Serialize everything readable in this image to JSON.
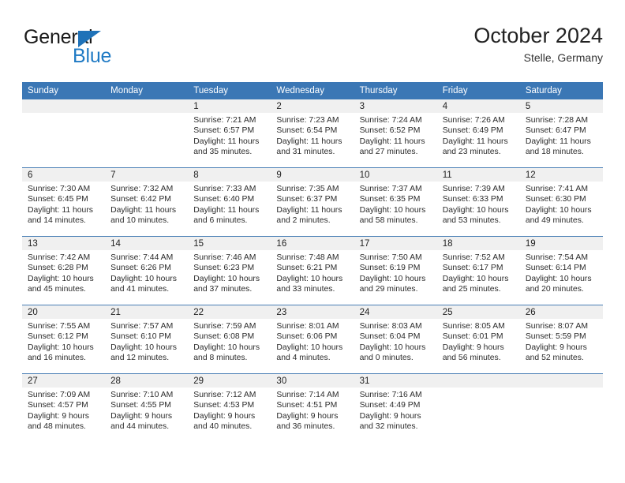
{
  "brand": {
    "name_top": "General",
    "name_bottom": "Blue",
    "triangle_color": "#1f72b8",
    "blue_color": "#1f7ac4"
  },
  "header": {
    "title": "October 2024",
    "subtitle": "Stelle, Germany"
  },
  "theme": {
    "header_bg": "#3b77b5",
    "daystrip_bg": "#f0f0f0",
    "row_divider": "#4a7fb5"
  },
  "weekdays": [
    "Sunday",
    "Monday",
    "Tuesday",
    "Wednesday",
    "Thursday",
    "Friday",
    "Saturday"
  ],
  "weeks": [
    [
      {
        "day": ""
      },
      {
        "day": ""
      },
      {
        "day": "1",
        "sunrise": "Sunrise: 7:21 AM",
        "sunset": "Sunset: 6:57 PM",
        "daylight": "Daylight: 11 hours and 35 minutes."
      },
      {
        "day": "2",
        "sunrise": "Sunrise: 7:23 AM",
        "sunset": "Sunset: 6:54 PM",
        "daylight": "Daylight: 11 hours and 31 minutes."
      },
      {
        "day": "3",
        "sunrise": "Sunrise: 7:24 AM",
        "sunset": "Sunset: 6:52 PM",
        "daylight": "Daylight: 11 hours and 27 minutes."
      },
      {
        "day": "4",
        "sunrise": "Sunrise: 7:26 AM",
        "sunset": "Sunset: 6:49 PM",
        "daylight": "Daylight: 11 hours and 23 minutes."
      },
      {
        "day": "5",
        "sunrise": "Sunrise: 7:28 AM",
        "sunset": "Sunset: 6:47 PM",
        "daylight": "Daylight: 11 hours and 18 minutes."
      }
    ],
    [
      {
        "day": "6",
        "sunrise": "Sunrise: 7:30 AM",
        "sunset": "Sunset: 6:45 PM",
        "daylight": "Daylight: 11 hours and 14 minutes."
      },
      {
        "day": "7",
        "sunrise": "Sunrise: 7:32 AM",
        "sunset": "Sunset: 6:42 PM",
        "daylight": "Daylight: 11 hours and 10 minutes."
      },
      {
        "day": "8",
        "sunrise": "Sunrise: 7:33 AM",
        "sunset": "Sunset: 6:40 PM",
        "daylight": "Daylight: 11 hours and 6 minutes."
      },
      {
        "day": "9",
        "sunrise": "Sunrise: 7:35 AM",
        "sunset": "Sunset: 6:37 PM",
        "daylight": "Daylight: 11 hours and 2 minutes."
      },
      {
        "day": "10",
        "sunrise": "Sunrise: 7:37 AM",
        "sunset": "Sunset: 6:35 PM",
        "daylight": "Daylight: 10 hours and 58 minutes."
      },
      {
        "day": "11",
        "sunrise": "Sunrise: 7:39 AM",
        "sunset": "Sunset: 6:33 PM",
        "daylight": "Daylight: 10 hours and 53 minutes."
      },
      {
        "day": "12",
        "sunrise": "Sunrise: 7:41 AM",
        "sunset": "Sunset: 6:30 PM",
        "daylight": "Daylight: 10 hours and 49 minutes."
      }
    ],
    [
      {
        "day": "13",
        "sunrise": "Sunrise: 7:42 AM",
        "sunset": "Sunset: 6:28 PM",
        "daylight": "Daylight: 10 hours and 45 minutes."
      },
      {
        "day": "14",
        "sunrise": "Sunrise: 7:44 AM",
        "sunset": "Sunset: 6:26 PM",
        "daylight": "Daylight: 10 hours and 41 minutes."
      },
      {
        "day": "15",
        "sunrise": "Sunrise: 7:46 AM",
        "sunset": "Sunset: 6:23 PM",
        "daylight": "Daylight: 10 hours and 37 minutes."
      },
      {
        "day": "16",
        "sunrise": "Sunrise: 7:48 AM",
        "sunset": "Sunset: 6:21 PM",
        "daylight": "Daylight: 10 hours and 33 minutes."
      },
      {
        "day": "17",
        "sunrise": "Sunrise: 7:50 AM",
        "sunset": "Sunset: 6:19 PM",
        "daylight": "Daylight: 10 hours and 29 minutes."
      },
      {
        "day": "18",
        "sunrise": "Sunrise: 7:52 AM",
        "sunset": "Sunset: 6:17 PM",
        "daylight": "Daylight: 10 hours and 25 minutes."
      },
      {
        "day": "19",
        "sunrise": "Sunrise: 7:54 AM",
        "sunset": "Sunset: 6:14 PM",
        "daylight": "Daylight: 10 hours and 20 minutes."
      }
    ],
    [
      {
        "day": "20",
        "sunrise": "Sunrise: 7:55 AM",
        "sunset": "Sunset: 6:12 PM",
        "daylight": "Daylight: 10 hours and 16 minutes."
      },
      {
        "day": "21",
        "sunrise": "Sunrise: 7:57 AM",
        "sunset": "Sunset: 6:10 PM",
        "daylight": "Daylight: 10 hours and 12 minutes."
      },
      {
        "day": "22",
        "sunrise": "Sunrise: 7:59 AM",
        "sunset": "Sunset: 6:08 PM",
        "daylight": "Daylight: 10 hours and 8 minutes."
      },
      {
        "day": "23",
        "sunrise": "Sunrise: 8:01 AM",
        "sunset": "Sunset: 6:06 PM",
        "daylight": "Daylight: 10 hours and 4 minutes."
      },
      {
        "day": "24",
        "sunrise": "Sunrise: 8:03 AM",
        "sunset": "Sunset: 6:04 PM",
        "daylight": "Daylight: 10 hours and 0 minutes."
      },
      {
        "day": "25",
        "sunrise": "Sunrise: 8:05 AM",
        "sunset": "Sunset: 6:01 PM",
        "daylight": "Daylight: 9 hours and 56 minutes."
      },
      {
        "day": "26",
        "sunrise": "Sunrise: 8:07 AM",
        "sunset": "Sunset: 5:59 PM",
        "daylight": "Daylight: 9 hours and 52 minutes."
      }
    ],
    [
      {
        "day": "27",
        "sunrise": "Sunrise: 7:09 AM",
        "sunset": "Sunset: 4:57 PM",
        "daylight": "Daylight: 9 hours and 48 minutes."
      },
      {
        "day": "28",
        "sunrise": "Sunrise: 7:10 AM",
        "sunset": "Sunset: 4:55 PM",
        "daylight": "Daylight: 9 hours and 44 minutes."
      },
      {
        "day": "29",
        "sunrise": "Sunrise: 7:12 AM",
        "sunset": "Sunset: 4:53 PM",
        "daylight": "Daylight: 9 hours and 40 minutes."
      },
      {
        "day": "30",
        "sunrise": "Sunrise: 7:14 AM",
        "sunset": "Sunset: 4:51 PM",
        "daylight": "Daylight: 9 hours and 36 minutes."
      },
      {
        "day": "31",
        "sunrise": "Sunrise: 7:16 AM",
        "sunset": "Sunset: 4:49 PM",
        "daylight": "Daylight: 9 hours and 32 minutes."
      },
      {
        "day": ""
      },
      {
        "day": ""
      }
    ]
  ]
}
